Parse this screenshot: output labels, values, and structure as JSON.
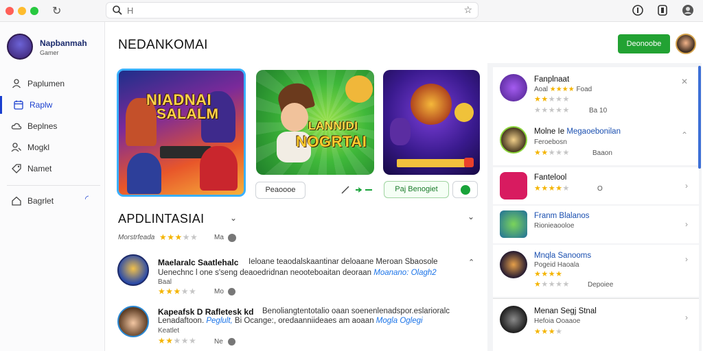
{
  "browser": {
    "url_value": "",
    "url_placeholder": "H"
  },
  "sidebar": {
    "profile_name": "Napbanmah",
    "profile_sub": "Gamer",
    "items": [
      {
        "label": "Paplumen",
        "icon": "user-icon"
      },
      {
        "label": "Raplw",
        "icon": "calendar-icon"
      },
      {
        "label": "Beplnes",
        "icon": "cloud-icon"
      },
      {
        "label": "Mogkl",
        "icon": "person-search-icon"
      },
      {
        "label": "Namet",
        "icon": "tag-icon"
      },
      {
        "label": "Bagrlet",
        "icon": "home-icon"
      }
    ]
  },
  "header": {
    "title": "NEDANKOMAI",
    "button_label": "Deonoobe"
  },
  "banners": [
    {
      "title_line1": "NIADNAI",
      "title_line2": "SALALM"
    },
    {
      "title_line1": "LANNIDI",
      "title_line2": "NOGRTAI"
    },
    {
      "title_line1": "",
      "title_line2": ""
    }
  ],
  "banner_actions": {
    "left_pill": "Peaoooe",
    "right_pill": "Paj Benogiet"
  },
  "section": {
    "title": "APDLINTASIAI",
    "meta_prefix": "Morstrfeada",
    "meta_rating": 3,
    "meta_suffix": "Ma"
  },
  "reviews": [
    {
      "title": "Maelaralc Saatlehalc",
      "title_rest": "Ieloane teaodalskaantinar deloaane Meroan Sbaosole",
      "line2": "Uenechnc l one s'seng deaoedridnan neooteboaitan deoraan",
      "line2_link": "Moanano: Olagh2",
      "line3": "Baal",
      "rating": 3,
      "meta": "Mo"
    },
    {
      "title": "Kapeafsk D Rafletesk kd",
      "title_rest": "Benoliangtentotalio oaan soenenlenadspor.eslarioralc",
      "line2": "Lenadaftoon.",
      "line2_link1": "Peglult,",
      "line2_mid": "Bi Ocange:, oredaanniideaes am aoaan",
      "line2_link2": "Mogla Oglegi",
      "line3": "Keatlet",
      "rating": 2,
      "meta": "Ne"
    }
  ],
  "right_panel": [
    {
      "name": "Fanplnaat",
      "sub": "Aoal",
      "sub_tail": "Foad",
      "rating_a": 4,
      "rating_b": 2,
      "meta": "Ba 10",
      "action": "close"
    },
    {
      "name": "Molne Ie",
      "name_link": "Megaoebonilan",
      "sub": "Feroebosn",
      "rating": 2,
      "meta": "Baaon",
      "action": "close"
    },
    {
      "name": "Fantelool",
      "rating": 4,
      "meta": "O",
      "action": "arrow"
    },
    {
      "name": "Franm Blalanos",
      "sub": "Rionieaooloe",
      "action": "arrow"
    },
    {
      "name": "Mnqla Sanooms",
      "sub": "Pogeid Haoala",
      "rating_a": 4,
      "rating_b": 1,
      "meta": "Depoiee",
      "action": "arrow"
    },
    {
      "name": "Menan Segj Stnal",
      "sub": "Hefoia Ooaaoe",
      "rating": 3,
      "action": "arrow"
    }
  ],
  "colors": {
    "primary_green": "#22a233",
    "accent_blue": "#1a73e8",
    "star_yellow": "#f4b400"
  }
}
